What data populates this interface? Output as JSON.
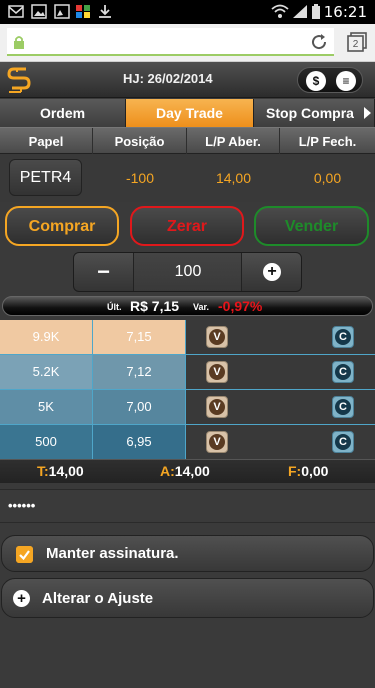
{
  "status": {
    "time": "16:21",
    "tab_count": "2"
  },
  "header": {
    "date": "HJ: 26/02/2014",
    "currency_btn": "$",
    "menu_btn": "≡"
  },
  "tabs": [
    {
      "label": "Ordem"
    },
    {
      "label": "Day Trade",
      "active": true
    },
    {
      "label": "Stop Compra"
    }
  ],
  "columns": [
    "Papel",
    "Posição",
    "L/P Aber.",
    "L/P Fech."
  ],
  "position": {
    "ticker": "PETR4",
    "qty": "-100",
    "lp_open": "14,00",
    "lp_close": "0,00"
  },
  "actions": {
    "buy": "Comprar",
    "reset": "Zerar",
    "sell": "Vender"
  },
  "stepper": {
    "minus": "−",
    "value": "100"
  },
  "last": {
    "label": "Últ.",
    "price": "R$ 7,15",
    "var_label": "Var.",
    "variation": "-0,97%"
  },
  "book": [
    {
      "qty": "9.9K",
      "price": "7,15",
      "qty_color": "#f0c9a2",
      "price_color": "#f0c9a2",
      "v": "V",
      "c": "C"
    },
    {
      "qty": "5.2K",
      "price": "7,12",
      "qty_color": "#7ba2b6",
      "price_color": "#6f97ab",
      "v": "V",
      "c": "C"
    },
    {
      "qty": "5K",
      "price": "7,00",
      "qty_color": "#5f8ea6",
      "price_color": "#56869e",
      "v": "V",
      "c": "C"
    },
    {
      "qty": "500",
      "price": "6,95",
      "qty_color": "#3a7591",
      "price_color": "#356e8b",
      "v": "V",
      "c": "C"
    }
  ],
  "totals": {
    "t_label": "T:",
    "t": "14,00",
    "a_label": "A:",
    "a": "14,00",
    "f_label": "F:",
    "f": "0,00"
  },
  "password": {
    "value": "••••••"
  },
  "keep_signature": {
    "label": "Manter assinatura.",
    "checked": true
  },
  "adjust": {
    "label": "Alterar o Ajuste"
  },
  "colors": {
    "accent": "#f5a623",
    "buy": "#f5a623",
    "reset": "#e0181b",
    "sell": "#1e8b2a"
  }
}
